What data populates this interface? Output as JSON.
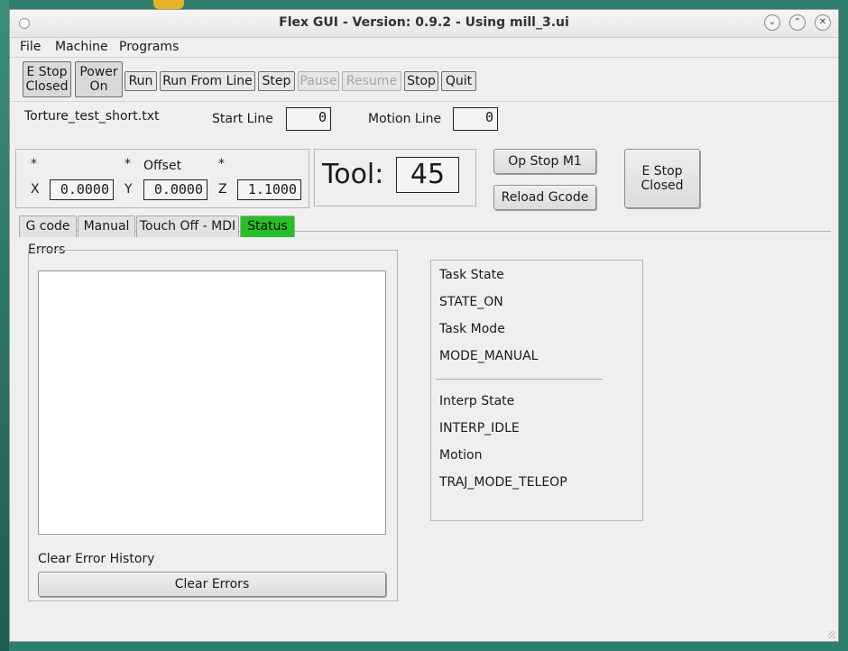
{
  "window": {
    "title": "Flex GUI - Version: 0.9.2 - Using mill_3.ui"
  },
  "menu": [
    "File",
    "Machine",
    "Programs"
  ],
  "toolbar": {
    "estop_line1": "E Stop",
    "estop_line2": "Closed",
    "power_line1": "Power",
    "power_line2": "On",
    "run": "Run",
    "run_from_line": "Run From Line",
    "step": "Step",
    "pause": "Pause",
    "resume": "Resume",
    "stop": "Stop",
    "quit": "Quit"
  },
  "file_info": {
    "filename": "Torture_test_short.txt",
    "start_line_label": "Start Line",
    "start_line_value": "0",
    "motion_line_label": "Motion Line",
    "motion_line_value": "0"
  },
  "dro": {
    "x_star": "*",
    "y_star": "*",
    "z_star": "*",
    "offset_label": "Offset",
    "x_label": "X",
    "x_value": "0.0000",
    "y_label": "Y",
    "y_value": "0.0000",
    "z_label": "Z",
    "z_value": "1.1000"
  },
  "tool": {
    "label": "Tool:",
    "value": "45"
  },
  "side_buttons": {
    "op_stop": "Op Stop M1",
    "reload": "Reload Gcode",
    "estop_line1": "E Stop",
    "estop_line2": "Closed"
  },
  "tabs": [
    "G code",
    "Manual",
    "Touch Off - MDI",
    "Status"
  ],
  "colors": {
    "active_tab": "#26c026"
  },
  "errors": {
    "group_label": "Errors",
    "clear_history_label": "Clear Error History",
    "clear_button": "Clear Errors"
  },
  "status": {
    "task_state_label": "Task State",
    "task_state_value": "STATE_ON",
    "task_mode_label": "Task Mode",
    "task_mode_value": "MODE_MANUAL",
    "interp_state_label": "Interp State",
    "interp_state_value": "INTERP_IDLE",
    "motion_label": "Motion",
    "motion_value": "TRAJ_MODE_TELEOP"
  }
}
